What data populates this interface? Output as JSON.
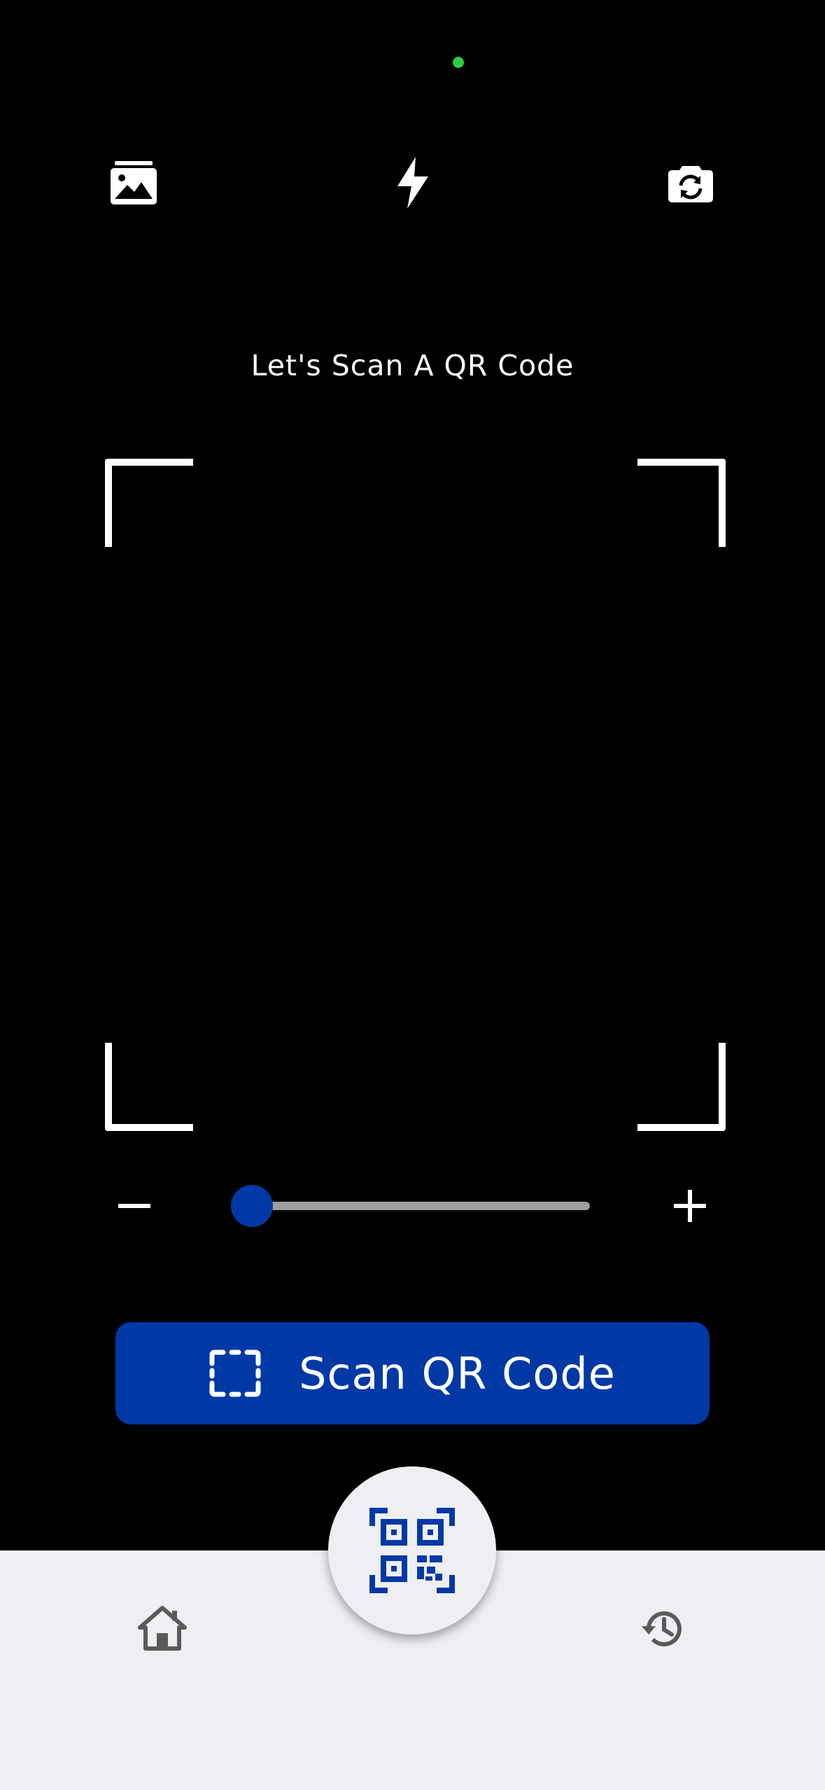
{
  "status": {
    "indicator_color": "#2ecc40"
  },
  "toolbar": {
    "gallery_icon": "gallery-icon",
    "flash_icon": "flash-icon",
    "switch_camera_icon": "switch-camera-icon"
  },
  "scanner": {
    "prompt": "Let's Scan A QR Code"
  },
  "zoom": {
    "minus_label": "−",
    "plus_label": "+",
    "level": 0.05
  },
  "scan_button": {
    "label": "Scan QR Code",
    "icon": "scan-frame-icon"
  },
  "bottom_nav": {
    "home_icon": "home-icon",
    "qr_icon": "qr-code-icon",
    "history_icon": "history-icon"
  },
  "colors": {
    "accent": "#0039a6",
    "background": "#000000",
    "nav_background": "#efeff3",
    "nav_icon": "#5a5a5a",
    "slider_track": "#9e9e9e"
  }
}
